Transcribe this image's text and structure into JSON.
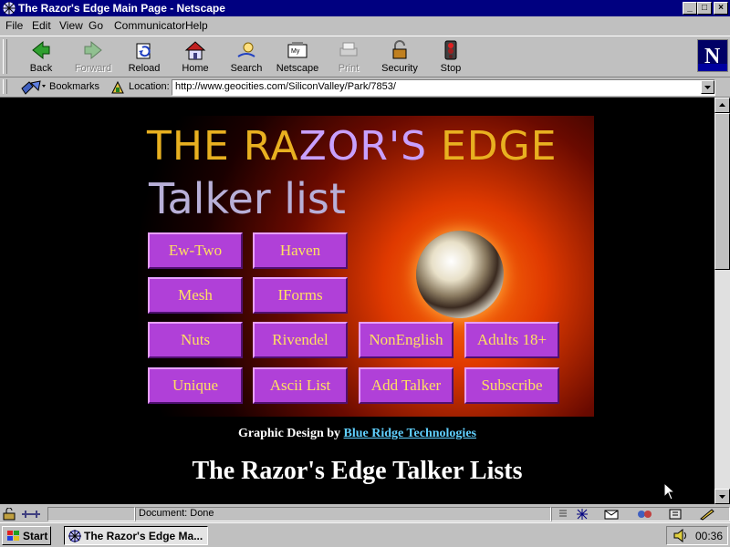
{
  "window": {
    "title": "The Razor's Edge Main Page - Netscape",
    "controls": [
      "_",
      "□",
      "×"
    ]
  },
  "menu": [
    "File",
    "Edit",
    "View",
    "Go",
    "Communicator",
    "Help"
  ],
  "toolbar": {
    "buttons": [
      {
        "label": "Back",
        "icon": "back-arrow-icon",
        "enabled": true
      },
      {
        "label": "Forward",
        "icon": "forward-arrow-icon",
        "enabled": false
      },
      {
        "label": "Reload",
        "icon": "reload-icon",
        "enabled": true
      },
      {
        "label": "Home",
        "icon": "home-icon",
        "enabled": true
      },
      {
        "label": "Search",
        "icon": "search-icon",
        "enabled": true
      },
      {
        "label": "Netscape",
        "icon": "netscape-icon",
        "enabled": true
      },
      {
        "label": "Print",
        "icon": "print-icon",
        "enabled": false
      },
      {
        "label": "Security",
        "icon": "security-lock-icon",
        "enabled": true
      },
      {
        "label": "Stop",
        "icon": "stop-icon",
        "enabled": true
      }
    ],
    "logo": "N"
  },
  "location_bar": {
    "bookmarks_label": "Bookmarks",
    "location_label": "Location:",
    "url": "http://www.geocities.com/SiliconValley/Park/7853/"
  },
  "page": {
    "banner": {
      "title_a": "THE RA",
      "title_z": "ZOR'S",
      "title_b": " EDGE",
      "subtitle": "Talker list",
      "buttons": [
        "Ew-Two",
        "Haven",
        "Mesh",
        "IForms",
        "Nuts",
        "Rivendel",
        "NonEnglish",
        "Adults 18+",
        "Unique",
        "Ascii List",
        "Add Talker",
        "Subscribe"
      ]
    },
    "credit_prefix": "Graphic Design by ",
    "credit_link": "Blue Ridge Technologies",
    "heading": "The Razor's Edge Talker Lists"
  },
  "status": {
    "text": "Document: Done"
  },
  "taskbar": {
    "start": "Start",
    "task": "The Razor's Edge Ma...",
    "clock": "00:36"
  },
  "colors": {
    "title_bar": "#000080",
    "page_bg": "#000000",
    "banner_button": "#b040d8",
    "banner_text": "#ffe060",
    "link": "#60d0ff"
  }
}
